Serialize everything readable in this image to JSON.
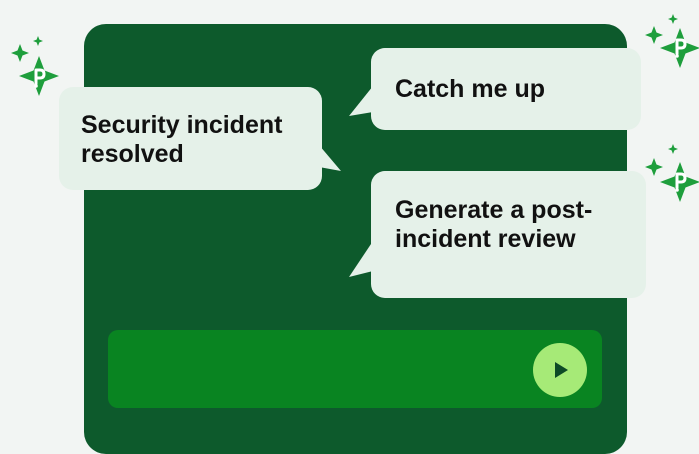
{
  "chat": {
    "messages": [
      {
        "role": "system",
        "text": "Security incident resolved"
      },
      {
        "role": "user",
        "text": "Catch me up"
      },
      {
        "role": "user",
        "text": "Generate a post- incident review"
      }
    ]
  },
  "composer": {
    "input_value": "",
    "send_icon": "play-triangle-icon"
  },
  "decorations": {
    "sparkle_icon": "sparkle-p-icon"
  },
  "colors": {
    "background": "#f2f5f3",
    "panel": "#0d5a2c",
    "composer": "#098421",
    "bubble": "#e5f1e9",
    "send_button": "#a6ea77",
    "sparkle": "#1e9e3c"
  }
}
